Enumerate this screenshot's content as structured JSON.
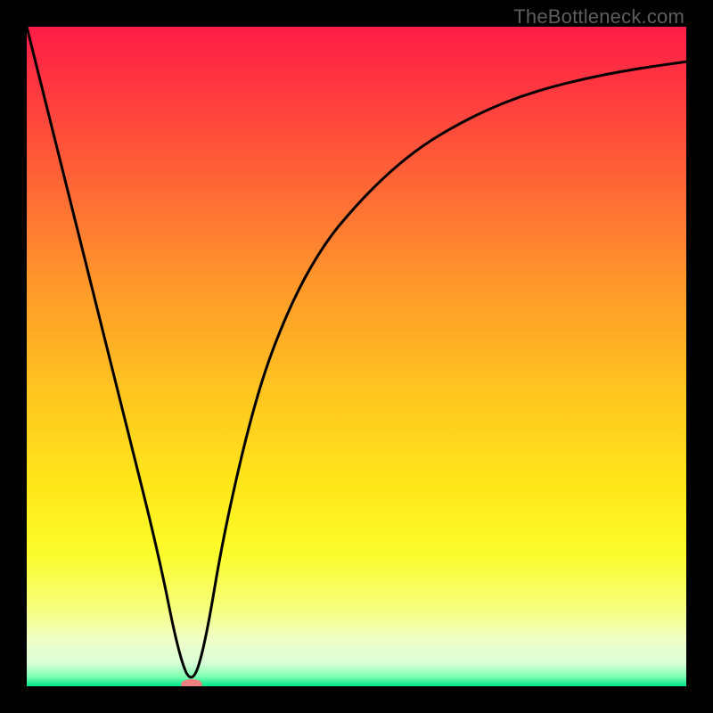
{
  "watermark": "TheBottleneck.com",
  "chart_data": {
    "type": "line",
    "title": "",
    "xlabel": "",
    "ylabel": "",
    "xlim": [
      0,
      100
    ],
    "ylim": [
      0,
      100
    ],
    "background_gradient_stops": [
      {
        "offset": 0.0,
        "color": "#ff1c47"
      },
      {
        "offset": 0.1,
        "color": "#ff3a3f"
      },
      {
        "offset": 0.25,
        "color": "#ff6a35"
      },
      {
        "offset": 0.4,
        "color": "#ff9a2a"
      },
      {
        "offset": 0.55,
        "color": "#ffc420"
      },
      {
        "offset": 0.7,
        "color": "#ffe81a"
      },
      {
        "offset": 0.8,
        "color": "#fbfc2c"
      },
      {
        "offset": 0.88,
        "color": "#f6ff7a"
      },
      {
        "offset": 0.93,
        "color": "#f0ffc8"
      },
      {
        "offset": 0.965,
        "color": "#d8ffd8"
      },
      {
        "offset": 0.985,
        "color": "#7fffb0"
      },
      {
        "offset": 1.0,
        "color": "#00e58a"
      }
    ],
    "series": [
      {
        "name": "bottleneck-curve",
        "x": [
          0,
          5,
          10,
          15,
          20,
          23,
          25,
          27,
          30,
          35,
          40,
          45,
          50,
          55,
          60,
          65,
          70,
          75,
          80,
          85,
          90,
          95,
          100
        ],
        "values": [
          100,
          80,
          60,
          40,
          20,
          5,
          0,
          6,
          24,
          45,
          58,
          67,
          73,
          78,
          82,
          85,
          87.5,
          89.5,
          91,
          92.2,
          93.2,
          94,
          94.7
        ]
      }
    ],
    "marker": {
      "x": 25,
      "y": 0,
      "color": "#f08080",
      "rx": 12,
      "ry": 6
    },
    "curve_color": "#000000",
    "curve_width": 3
  }
}
